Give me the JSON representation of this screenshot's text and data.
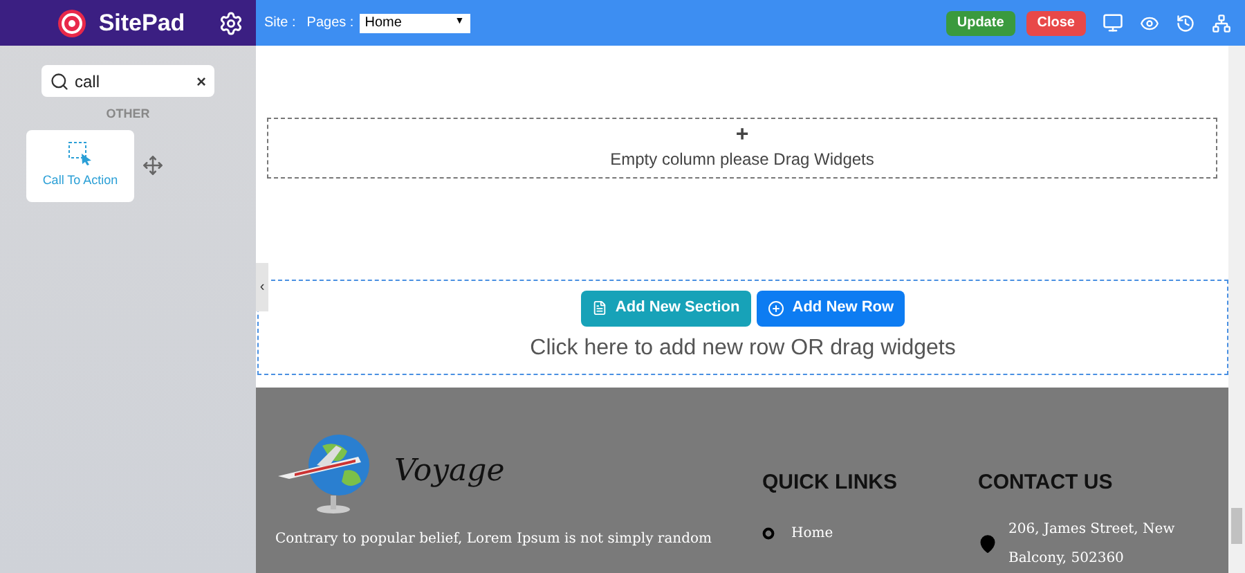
{
  "sidebar": {
    "brand": "SitePad",
    "search": {
      "value": "call",
      "clear": "×"
    },
    "group_label": "OTHER",
    "widgets": [
      {
        "label": "Call To Action"
      }
    ],
    "collapse": "‹"
  },
  "toolbar": {
    "site_label": "Site :",
    "pages_label": "Pages :",
    "pages_value": "Home",
    "pages_caret": "▼",
    "buttons": [
      {
        "label": "Update",
        "kind": "update"
      },
      {
        "label": "Close",
        "kind": "close"
      }
    ]
  },
  "canvas": {
    "empty_column": {
      "plus": "+",
      "text": "Empty column please Drag Widgets"
    },
    "add_row": {
      "buttons": [
        {
          "label": "Add New Section",
          "kind": "section"
        },
        {
          "label": "Add New Row",
          "kind": "row"
        }
      ],
      "hint": "Click here to add new row OR drag widgets"
    }
  },
  "footer": {
    "logo_text": "Voyage",
    "about": "Contrary to popular belief, Lorem Ipsum is not simply random",
    "quick_links": {
      "title": "QUICK LINKS",
      "items": [
        "Home"
      ]
    },
    "contact": {
      "title": "CONTACT US",
      "address": "206, James Street, New Balcony, 502360"
    }
  }
}
